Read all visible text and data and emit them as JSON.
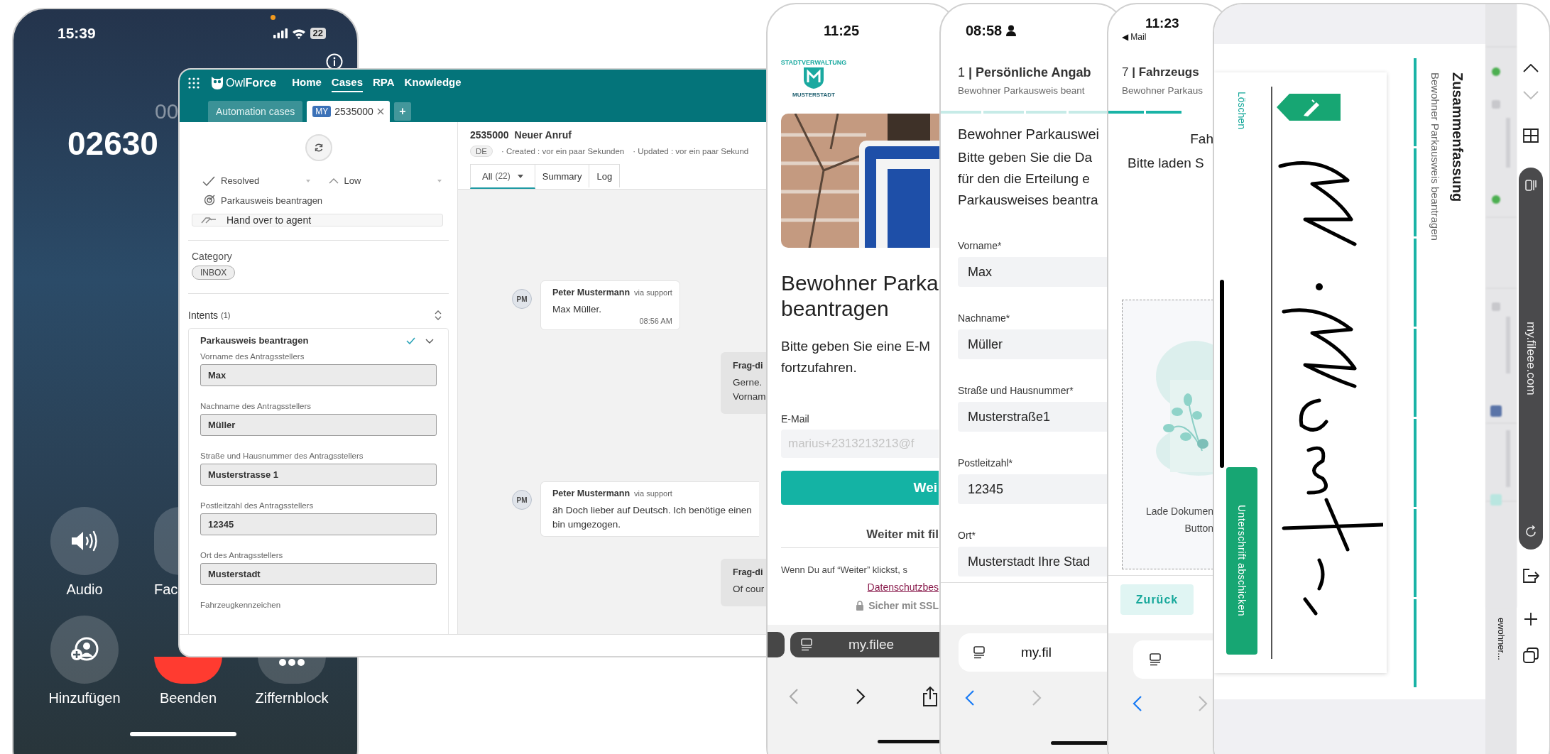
{
  "call_screen": {
    "time": "15:39",
    "battery": "22",
    "elapsed": "00",
    "number": "02630",
    "actions_top": [
      {
        "kind": "audio",
        "label": "Audio"
      },
      {
        "kind": "facetime",
        "label": "Fac"
      }
    ],
    "actions_bottom": [
      {
        "kind": "add",
        "label": "Hinzufügen"
      },
      {
        "kind": "end",
        "label": "Beenden"
      },
      {
        "kind": "keypad",
        "label": "Ziffernblock"
      }
    ]
  },
  "crm": {
    "brand": "Owl**Force**",
    "nav": [
      {
        "label": "Home",
        "selected": false
      },
      {
        "label": "Cases",
        "selected": true
      },
      {
        "label": "RPA",
        "selected": false
      },
      {
        "label": "Knowledge",
        "selected": false
      }
    ],
    "tabs": [
      {
        "label": "Automation cases",
        "selected": false
      },
      {
        "badge": "MY",
        "label": "2535000",
        "selected": true
      }
    ],
    "add_tab": "+",
    "status": "Resolved",
    "priority": "Low",
    "intent_tag": "Parkausweis beantragen",
    "handover": "Hand over to agent",
    "category_title": "Category",
    "category": "INBOX",
    "intents_title": "Intents",
    "intents_count": "(1)",
    "intent": {
      "title": "Parkausweis beantragen",
      "confirmed": true,
      "expanded": true,
      "fields": [
        {
          "label": "Vorname des Antragsstellers",
          "value": "Max"
        },
        {
          "label": "Nachname des Antragsstellers",
          "value": "Müller"
        },
        {
          "label": "Straße und Hausnummer des Antragsstellers",
          "value": "Musterstrasse 1"
        },
        {
          "label": "Postleitzahl des Antragsstellers",
          "value": "12345"
        },
        {
          "label": "Ort des Antragsstellers",
          "value": "Musterstadt"
        }
      ],
      "next_label": "Fahrzeugkennzeichen"
    },
    "case_id": "2535000",
    "case_title": "Neuer Anruf",
    "language": "DE",
    "created": "· Created : vor ein paar Sekunden",
    "updated": "· Updated : vor ein paar Sekund",
    "views": [
      {
        "label": "All",
        "count": "(22)",
        "selected": true
      },
      {
        "label": "Summary",
        "selected": false
      },
      {
        "label": "Log",
        "selected": false
      }
    ],
    "messages": [
      {
        "kind": "incoming",
        "avatar": "PM",
        "author": "Peter Mustermann",
        "channel": "via support",
        "lines": [
          "Max Müller."
        ],
        "time": "08:56 AM"
      },
      {
        "kind": "outgoing",
        "author": "Frag-di",
        "lines": [
          "Gerne.",
          "Vornam"
        ]
      },
      {
        "kind": "incoming",
        "avatar": "PM",
        "author": "Peter Mustermann",
        "channel": "via support",
        "lines": [
          "äh Doch lieber auf Deutsch. Ich benötige einen",
          "bin umgezogen."
        ]
      },
      {
        "kind": "outgoing",
        "author": "Frag-di",
        "lines": [
          "Of cour"
        ]
      }
    ]
  },
  "signup_phone": {
    "time": "11:25",
    "logo_arc": "STADTVERWALTUNG",
    "logo_name": "MUSTERSTADT",
    "title_lines": [
      "Bewohner Parka",
      "beantragen"
    ],
    "intro_lines": [
      "Bitte geben Sie eine E-M",
      "fortzufahren."
    ],
    "email_label": "E-Mail",
    "email_placeholder": "marius+2313213213@f",
    "submit": "Wei",
    "alt_login": "Weiter mit fil",
    "consent": "Wenn Du auf “Weiter” klickst, s",
    "privacy_link": "Datenschutzbes",
    "secure": "Sicher mit SSL",
    "url": "my.filee"
  },
  "form_phone": {
    "time": "08:58",
    "step": "1 **| Persönliche Angab**",
    "subtitle": "Bewohner Parkausweis beant",
    "steps": [
      {
        "done": false
      },
      {
        "done": false
      },
      {
        "done": false
      },
      {
        "done": false
      }
    ],
    "section": "Bewohner Parkauswei",
    "intro_lines": [
      "Bitte geben Sie die Da",
      "für den die Erteilung e",
      "Parkausweises beantra"
    ],
    "fields": [
      {
        "label": "Vorname*",
        "value": "Max"
      },
      {
        "label": "Nachname*",
        "value": "Müller"
      },
      {
        "label": "Straße und Hausnummer*",
        "value": "Musterstraße1"
      },
      {
        "label": "Postleitzahl*",
        "value": "12345"
      },
      {
        "label": "Ort*",
        "value": "Musterstadt Ihre Stad"
      }
    ],
    "url": "my.fil"
  },
  "upload_phone": {
    "time": "11:23",
    "back_app": "◀ Mail",
    "step": "7 **| Fahrzeugs**",
    "subtitle": "Bewohner Parkaus",
    "steps": [
      {
        "done": true
      },
      {
        "done": true
      }
    ],
    "heading": "Fah",
    "intro": "Bitte laden S",
    "upload_lines": [
      "Lade Dokumen",
      "Button"
    ],
    "back_button": "Zurück"
  },
  "signature_phone": {
    "clear": "Löschen",
    "submit": "Unterschrift abschicken",
    "title": "Zusammenfassung",
    "subtitle": "Bewohner Parkausweis beantragen",
    "steps": [
      {
        "done": true
      },
      {
        "done": true
      },
      {
        "done": true
      },
      {
        "done": true
      },
      {
        "done": true
      },
      {
        "done": true
      },
      {
        "done": true
      }
    ],
    "tab_label": "ewohner...",
    "url": "my.fileee.com"
  }
}
